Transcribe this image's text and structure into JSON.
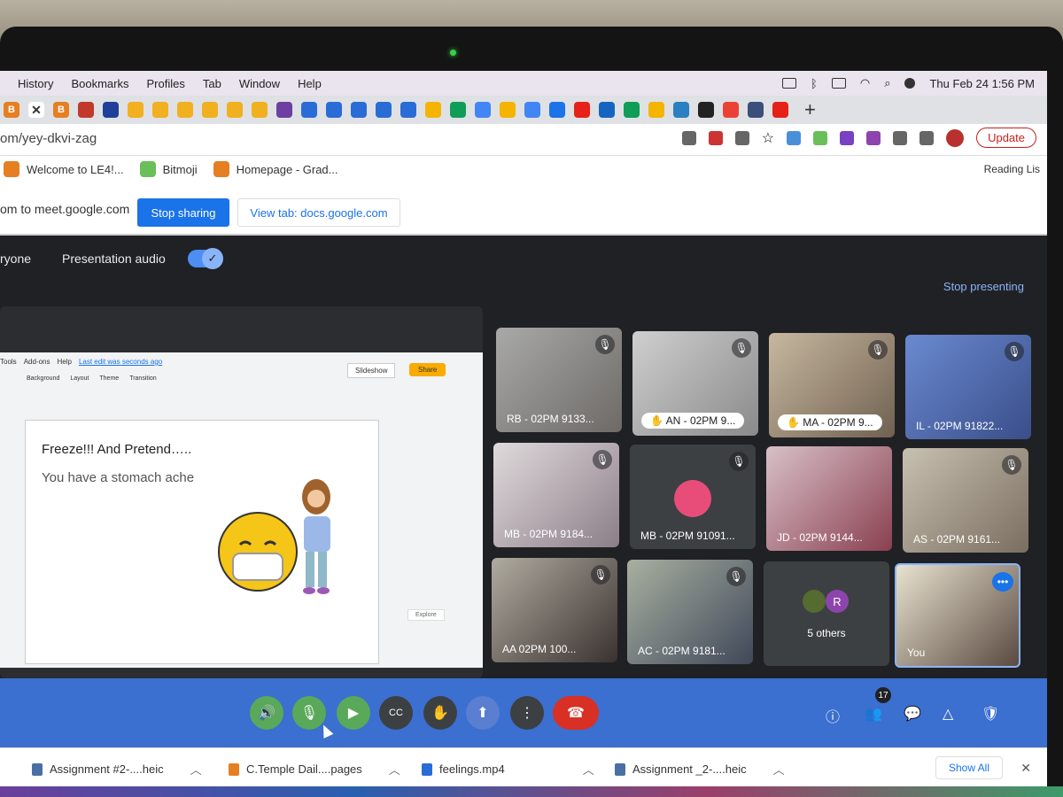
{
  "menubar": {
    "items": [
      "History",
      "Bookmarks",
      "Profiles",
      "Tab",
      "Window",
      "Help"
    ],
    "clock": "Thu Feb 24  1:56 PM"
  },
  "omnibox": {
    "url": "om/yey-dkvi-zag",
    "update_label": "Update"
  },
  "bookmarks": {
    "items": [
      "Welcome to LE4!...",
      "Bitmoji",
      "Homepage - Grad..."
    ],
    "reading_list": "Reading Lis"
  },
  "sharebar": {
    "text": "om to meet.google.com",
    "stop_label": "Stop sharing",
    "view_label": "View tab: docs.google.com"
  },
  "meet": {
    "everyone": "ryone",
    "presentation_audio": "Presentation audio",
    "stop_presenting": "Stop presenting",
    "participant_count": "17"
  },
  "slides": {
    "menus": [
      "Tools",
      "Add-ons",
      "Help"
    ],
    "last_edit": "Last edit was seconds ago",
    "toolbar": [
      "Background",
      "Layout",
      "Theme",
      "Transition"
    ],
    "slideshow_label": "Slideshow",
    "share_label": "Share",
    "title": "Freeze!!! And Pretend…..",
    "body": "You have a stomach ache",
    "explore_label": "Explore"
  },
  "tiles": [
    {
      "name": "RB - 02PM 9133..."
    },
    {
      "name": "AN - 02PM 9..."
    },
    {
      "name": "MA - 02PM 9..."
    },
    {
      "name": "IL - 02PM 91822..."
    },
    {
      "name": "MB - 02PM 9184..."
    },
    {
      "name": "MB - 02PM 91091..."
    },
    {
      "name": "JD - 02PM 9144..."
    },
    {
      "name": "AS - 02PM 9161..."
    },
    {
      "name": "AA  02PM 100..."
    },
    {
      "name": "AC - 02PM 9181..."
    },
    {
      "name": "5 others",
      "initial": "R"
    },
    {
      "name": "You"
    }
  ],
  "downloads": {
    "items": [
      "Assignment #2-....heic",
      "C.Temple Dail....pages",
      "feelings.mp4",
      "Assignment _2-....heic"
    ],
    "show_all": "Show All"
  }
}
